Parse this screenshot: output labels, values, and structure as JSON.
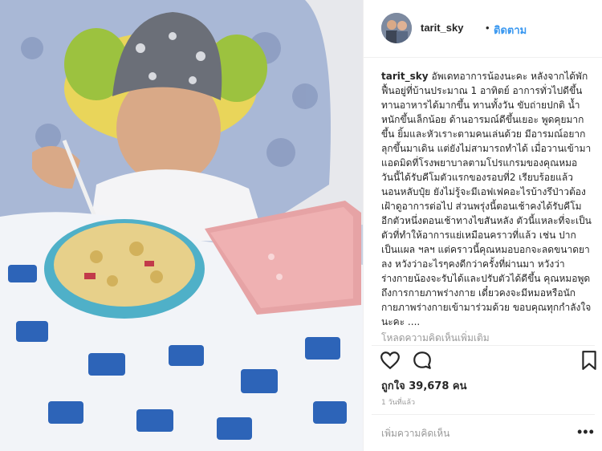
{
  "post": {
    "username": "tarit_sky",
    "separator": "•",
    "follow_label": "ติดตาม",
    "caption_user": "tarit_sky",
    "caption_text": "อัพเดทอาการน้องนะคะ หลังจากได้พักฟื้นอยู่ที่บ้านประมาณ 1 อาทิตย์ อาการทั่วไปดีขึ้น ทานอาหารได้มากขึ้น ทานทั้งวัน ขับถ่ายปกติ น้ำหนักขึ้นเล็กน้อย ด้านอารมณ์ดีขึ้นเยอะ พูดคุยมากขึ้น ยิ้มและหัวเราะตามคนเล่นด้วย มีอารมณ์อยากลุกขึ้นมาเดิน แต่ยังไม่สามารถทำได้ เมื่อวานเข้ามาแอดมิดที่โรงพยาบาลตามโปรแกรมของคุณหมอ วันนี้ได้รับคีโมตัวแรกของรอบที่2 เรียบร้อยแล้ว นอนหลับปุ๋ย ยังไม่รู้จะมีเอฟเฟคอะไรบ้างรึป่าวต้องเฝ้าดูอาการต่อไป ส่วนพรุ่งนี้ตอนเช้าคงได้รับคีโมอีกตัวหนึ่งตอนเช้าทางไขสันหลัง ตัวนี้แหละที่จะเป็นตัวที่ทำให้อาการแย่เหมือนคราวที่แล้ว เช่น ปากเป็นแผล ฯลฯ แต่คราวนี้คุณหมอบอกจะลดขนาดยาลง หวังว่าอะไรๆคงดีกว่าครั้งที่ผ่านมา หวังว่าร่างกายน้องจะรับได้และปรับตัวได้ดีขึ้น คุณหมอพูดถึงการกายภาพร่างกาย เดี๋ยวคงจะมีหมอหรือนักกายภาพร่างกายเข้ามาร่วมด้วย ขอบคุณทุกกำลังใจนะคะ ....",
    "load_more_label": "โหลดความคิดเห็นเพิ่มเติม",
    "likes_text": "ถูกใจ 39,678 คน",
    "time_ago": "1 วันที่แล้ว",
    "comment_placeholder": "เพิ่มความคิดเห็น",
    "more_label": "•••"
  },
  "icons": {
    "like": "heart-icon",
    "comment": "comment-icon",
    "save": "bookmark-icon",
    "more": "more-options-icon"
  },
  "colors": {
    "link": "#3897f0",
    "text": "#262626",
    "muted": "#999999",
    "border": "#efefef"
  }
}
